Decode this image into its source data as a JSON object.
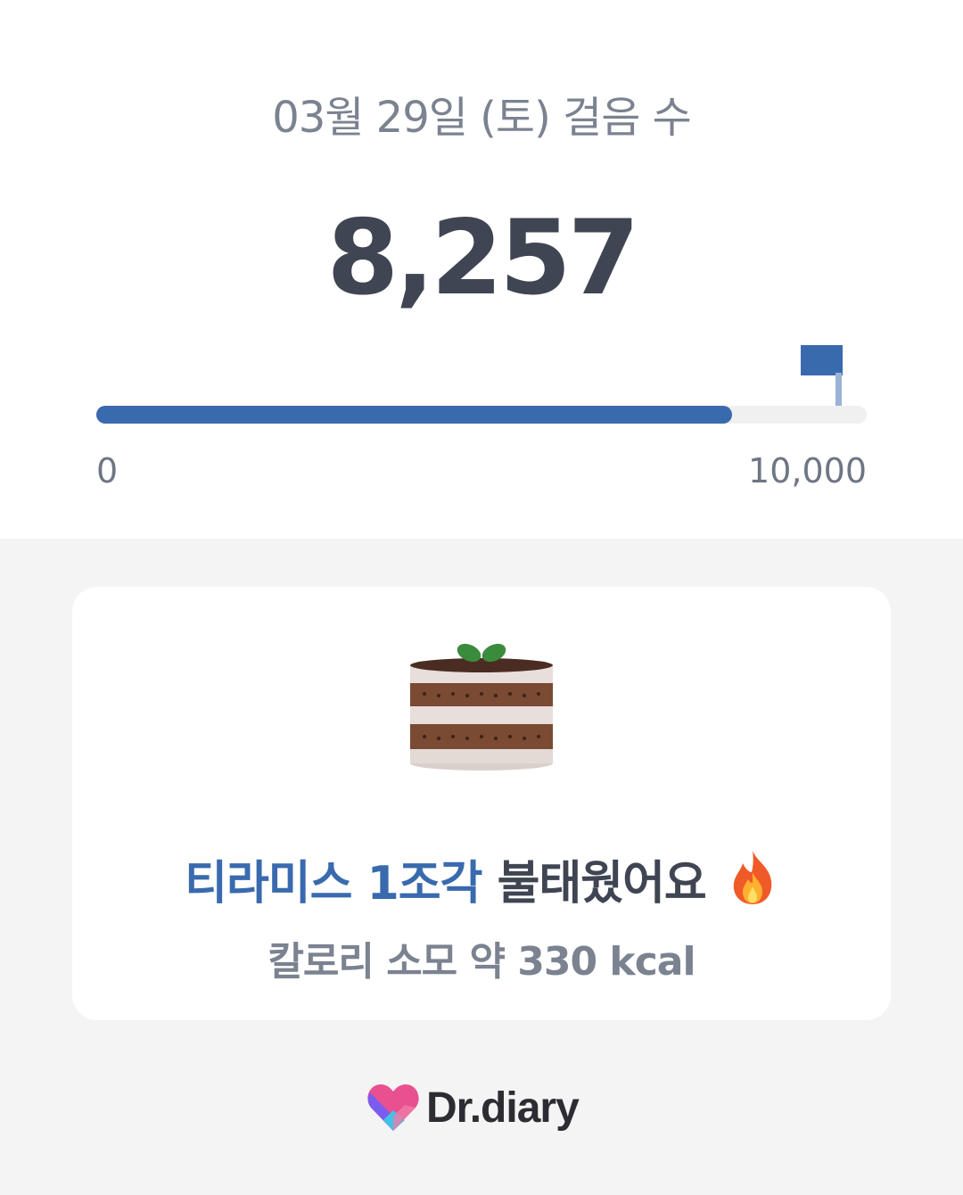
{
  "header": {
    "date_title": "03월 29일 (토) 걸음 수",
    "steps": "8,257"
  },
  "progress": {
    "value": 8257,
    "goal": 10000,
    "fraction": 0.8257,
    "min_label": "0",
    "max_label": "10,000",
    "fill_color": "#3a6aae",
    "goal_icon": "flag-icon"
  },
  "card": {
    "icon": "tiramisu-cake-icon",
    "food_label": "티라미스 1조각",
    "burn_suffix": "불태웠어요",
    "emoji_icon": "fire-icon",
    "calorie_text": "칼로리 소모 약 330 kcal"
  },
  "brand": {
    "name": "Dr.diary",
    "icon": "heart-logo-icon"
  },
  "colors": {
    "accent": "#3a6aae",
    "text_dark": "#3f4552",
    "text_muted": "#7b8290",
    "background": "#f4f4f4"
  }
}
